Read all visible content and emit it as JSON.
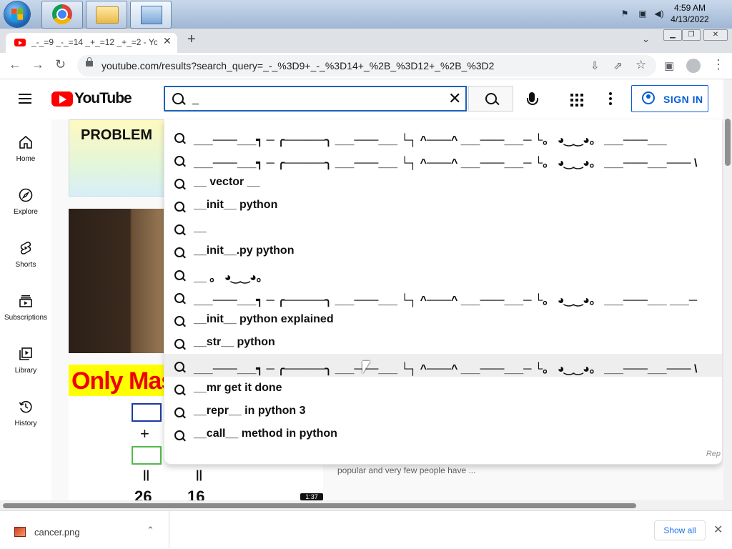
{
  "taskbar": {
    "time": "4:59 AM",
    "date": "4/13/2022"
  },
  "browser": {
    "tab_title": "_-_=9 _-_=14 _+_=12 _+_=2 - YouTube",
    "new_tab": "+",
    "tab_close": "✕",
    "url": "youtube.com/results?search_query=_-_%3D9+_-_%3D14+_%2B_%3D12+_%2B_%3D2"
  },
  "youtube": {
    "logo_text": "YouTube",
    "search_value": "_",
    "signin_label": "SIGN IN",
    "guide": [
      {
        "label": "Home"
      },
      {
        "label": "Explore"
      },
      {
        "label": "Shorts"
      },
      {
        "label": "Subscriptions"
      },
      {
        "label": "Library"
      },
      {
        "label": "History"
      }
    ],
    "suggestions": [
      "___───___┑ ─ ╭─────╮ ___───___ └┐ ^───^ ___───___─ └。 ◕‿‿◕。 ___───___",
      "___───___┑ ─ ╭─────╮ ___───___ └┐ ^───^ ___───___─ └。 ◕‿‿◕。 ___───___─── \\",
      "__ vector __",
      "__init__ python",
      "__",
      "__init__.py python",
      "__ 。 ◕‿‿◕。",
      "___───___┑ ─ ╭─────╮ ___───___ └┐ ^───^ ___───___─ └。 ◕‿‿◕。 ___───___ ___─",
      "__init__ python explained",
      "__str__ python",
      "___───___┑ ─ ╭─────╮ ___───___ └┐ ^───^ ___───___─ └。 ◕‿‿◕。 ___───___─── \\",
      "__mr get it done",
      "__repr__ in python 3",
      "__call__ method in python"
    ],
    "report_label": "Rep",
    "thumb1_text": "PROBLEM",
    "thumb3_text": "Only Mast",
    "thumb3_plus": "+",
    "thumb3_eq1": "||",
    "thumb3_eq2": "||",
    "thumb3_n1": "26",
    "thumb3_n2": "16",
    "duration": "1:37",
    "snippet": "popular and very few people have ..."
  },
  "downloads": {
    "file_name": "cancer.png",
    "show_all": "Show all"
  }
}
